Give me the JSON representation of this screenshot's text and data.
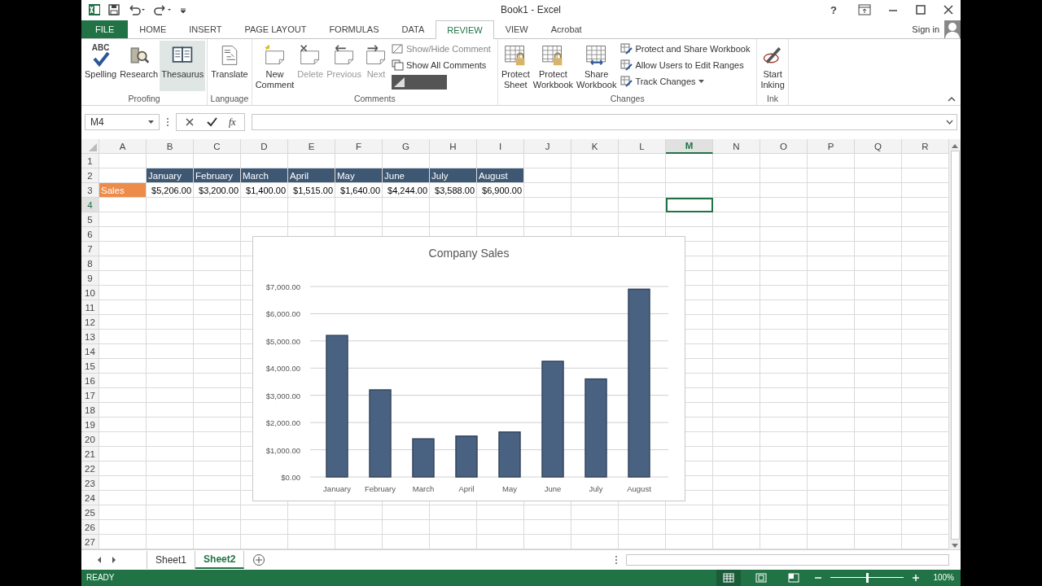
{
  "title_bar": {
    "title": "Book1 - Excel",
    "help": "?"
  },
  "tabs": [
    {
      "label": "FILE",
      "kind": "file",
      "selected": false
    },
    {
      "label": "HOME",
      "kind": "tab",
      "selected": false
    },
    {
      "label": "INSERT",
      "kind": "tab",
      "selected": false
    },
    {
      "label": "PAGE LAYOUT",
      "kind": "tab",
      "selected": false
    },
    {
      "label": "FORMULAS",
      "kind": "tab",
      "selected": false
    },
    {
      "label": "DATA",
      "kind": "tab",
      "selected": false
    },
    {
      "label": "REVIEW",
      "kind": "tab",
      "selected": true
    },
    {
      "label": "VIEW",
      "kind": "tab",
      "selected": false
    },
    {
      "label": "Acrobat",
      "kind": "tab",
      "selected": false
    }
  ],
  "sign_in": "Sign in",
  "ribbon": {
    "groups": [
      {
        "name": "Proofing",
        "items": [
          {
            "kind": "large",
            "label": "Spelling",
            "icon_text": "ABC",
            "disabled": false,
            "hovered": false
          },
          {
            "kind": "large",
            "label": "Research",
            "disabled": false,
            "hovered": false
          },
          {
            "kind": "large",
            "label": "Thesaurus",
            "disabled": false,
            "hovered": true
          }
        ]
      },
      {
        "name": "Language",
        "items": [
          {
            "kind": "large",
            "label": "Translate",
            "disabled": false,
            "hovered": false
          }
        ]
      },
      {
        "name": "Comments",
        "items": [
          {
            "kind": "large",
            "label": "New Comment",
            "disabled": false,
            "hovered": false
          },
          {
            "kind": "large",
            "label": "Delete",
            "disabled": true,
            "hovered": false
          },
          {
            "kind": "large",
            "label": "Previous",
            "disabled": true,
            "hovered": false
          },
          {
            "kind": "large",
            "label": "Next",
            "disabled": true,
            "hovered": false
          },
          {
            "kind": "small",
            "label": "Show/Hide Comment",
            "disabled": true,
            "dropdown": false
          },
          {
            "kind": "small",
            "label": "Show All Comments",
            "disabled": false,
            "dropdown": false
          },
          {
            "kind": "dark"
          }
        ]
      },
      {
        "name": "Changes",
        "items": [
          {
            "kind": "large",
            "label": "Protect Sheet",
            "disabled": false,
            "hovered": false
          },
          {
            "kind": "large",
            "label": "Protect Workbook",
            "disabled": false,
            "hovered": false
          },
          {
            "kind": "large",
            "label": "Share Workbook",
            "disabled": false,
            "hovered": false
          },
          {
            "kind": "small",
            "label": "Protect and Share Workbook",
            "disabled": false,
            "dropdown": false
          },
          {
            "kind": "small",
            "label": "Allow Users to Edit Ranges",
            "disabled": false,
            "dropdown": false
          },
          {
            "kind": "small",
            "label": "Track Changes",
            "disabled": false,
            "dropdown": true
          }
        ]
      },
      {
        "name": "Ink",
        "items": [
          {
            "kind": "large",
            "label": "Start Inking",
            "disabled": false,
            "hovered": false
          }
        ]
      }
    ]
  },
  "formula_bar": {
    "name_box": "M4",
    "function_button": "fx"
  },
  "sheet": {
    "columns": [
      {
        "label": "A",
        "selected": false
      },
      {
        "label": "B",
        "selected": false
      },
      {
        "label": "C",
        "selected": false
      },
      {
        "label": "D",
        "selected": false
      },
      {
        "label": "E",
        "selected": false
      },
      {
        "label": "F",
        "selected": false
      },
      {
        "label": "G",
        "selected": false
      },
      {
        "label": "H",
        "selected": false
      },
      {
        "label": "I",
        "selected": false
      },
      {
        "label": "J",
        "selected": false
      },
      {
        "label": "K",
        "selected": false
      },
      {
        "label": "L",
        "selected": false
      },
      {
        "label": "M",
        "selected": true
      },
      {
        "label": "N",
        "selected": false
      },
      {
        "label": "O",
        "selected": false
      },
      {
        "label": "P",
        "selected": false
      },
      {
        "label": "Q",
        "selected": false
      },
      {
        "label": "R",
        "selected": false
      }
    ],
    "rows": [
      {
        "label": "1",
        "selected": false
      },
      {
        "label": "2",
        "selected": false
      },
      {
        "label": "3",
        "selected": false
      },
      {
        "label": "4",
        "selected": true
      },
      {
        "label": "5",
        "selected": false
      },
      {
        "label": "6",
        "selected": false
      },
      {
        "label": "7",
        "selected": false
      },
      {
        "label": "8",
        "selected": false
      },
      {
        "label": "9",
        "selected": false
      },
      {
        "label": "10",
        "selected": false
      },
      {
        "label": "11",
        "selected": false
      },
      {
        "label": "12",
        "selected": false
      },
      {
        "label": "13",
        "selected": false
      },
      {
        "label": "14",
        "selected": false
      },
      {
        "label": "15",
        "selected": false
      },
      {
        "label": "16",
        "selected": false
      },
      {
        "label": "17",
        "selected": false
      },
      {
        "label": "18",
        "selected": false
      },
      {
        "label": "19",
        "selected": false
      },
      {
        "label": "20",
        "selected": false
      },
      {
        "label": "21",
        "selected": false
      },
      {
        "label": "22",
        "selected": false
      },
      {
        "label": "23",
        "selected": false
      },
      {
        "label": "24",
        "selected": false
      },
      {
        "label": "25",
        "selected": false
      },
      {
        "label": "26",
        "selected": false
      },
      {
        "label": "27",
        "selected": false
      }
    ],
    "table": {
      "headers": [
        "January",
        "February",
        "March",
        "April",
        "May",
        "June",
        "July",
        "August"
      ],
      "rows": [
        {
          "label": "Sales",
          "values": [
            "$5,206.00",
            "$3,200.00",
            "$1,400.00",
            "$1,515.00",
            "$1,640.00",
            "$4,244.00",
            "$3,588.00",
            "$6,900.00"
          ]
        }
      ]
    },
    "chart": {
      "chart_data": {
        "type": "bar",
        "title": "Company Sales",
        "grid": true,
        "categories": [
          "January",
          "February",
          "March",
          "April",
          "May",
          "June",
          "July",
          "August"
        ],
        "series": [
          {
            "color": "#4a6282",
            "values": [
              5200,
              3200,
              1400,
              1500,
              1650,
              4250,
              3600,
              6900
            ]
          }
        ],
        "ylim": [
          0,
          7000
        ],
        "yticks": [
          {
            "value": 0,
            "label": "$0.00"
          },
          {
            "value": 1000,
            "label": "$1,000.00"
          },
          {
            "value": 2000,
            "label": "$2,000.00"
          },
          {
            "value": 3000,
            "label": "$3,000.00"
          },
          {
            "value": 4000,
            "label": "$4,000.00"
          },
          {
            "value": 5000,
            "label": "$5,000.00"
          },
          {
            "value": 6000,
            "label": "$6,000.00"
          },
          {
            "value": 7000,
            "label": "$7,000.00"
          }
        ]
      }
    }
  },
  "sheet_tabs": [
    {
      "label": "Sheet1",
      "selected": false
    },
    {
      "label": "Sheet2",
      "selected": true
    }
  ],
  "status_bar": {
    "status": "READY",
    "views": [
      {
        "selected": true
      },
      {
        "selected": false
      },
      {
        "selected": false
      }
    ],
    "zoom_slider": {
      "level": 0.5
    },
    "zoom": "100%"
  }
}
